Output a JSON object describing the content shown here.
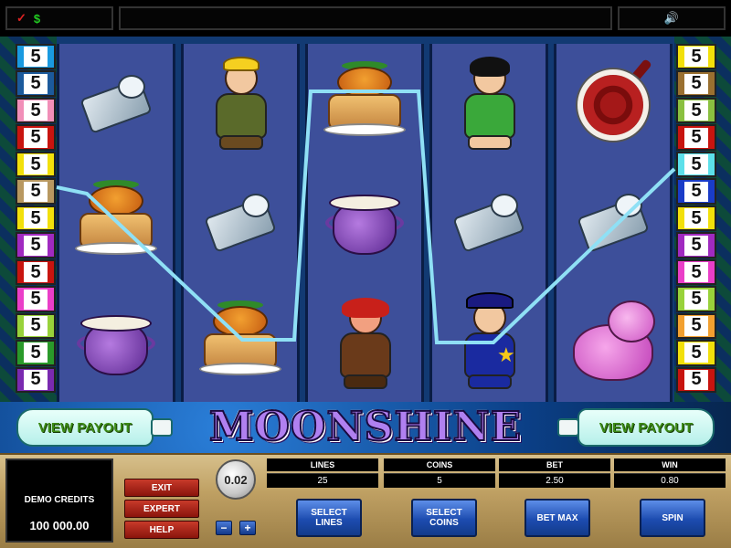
{
  "game": {
    "title": "MOONSHINE"
  },
  "topbar": {
    "icons": [
      "check-icon",
      "dollar-icon",
      "sound-icon"
    ],
    "check_glyph": "✓",
    "dollar_glyph": "$",
    "sound_glyph": "🔊"
  },
  "paylines": {
    "left_numbers": [
      "5",
      "5",
      "5",
      "5",
      "5",
      "5",
      "5",
      "5",
      "5",
      "5",
      "5",
      "5",
      "5"
    ],
    "right_numbers": [
      "5",
      "5",
      "5",
      "5",
      "5",
      "5",
      "5",
      "5",
      "5",
      "5",
      "5",
      "5",
      "5"
    ],
    "left_colors": [
      "#1a9ae0",
      "#1c5a9c",
      "#f18fb8",
      "#c8140f",
      "#f2e00a",
      "#b89860",
      "#f2e00a",
      "#a02ac0",
      "#c8140f",
      "#ea3ec8",
      "#98d23a",
      "#2a9a2a",
      "#7a2ab0"
    ],
    "right_colors": [
      "#f2e00a",
      "#9a7030",
      "#8ac040",
      "#c8140f",
      "#5ce0ea",
      "#1a3cc8",
      "#f2e00a",
      "#a02ac0",
      "#ea3ec8",
      "#98d23a",
      "#f2a030",
      "#f2e00a",
      "#c8140f"
    ]
  },
  "reels": [
    [
      "sardines",
      "pumpkin-pie",
      "moonshine-pot"
    ],
    [
      "hillbilly-banjo",
      "sardines",
      "pumpkin-pie"
    ],
    [
      "pumpkin-pie",
      "moonshine-pot",
      "red-haired-troll"
    ],
    [
      "big-guy",
      "sardines",
      "sheriff"
    ],
    [
      "beans-pan",
      "sardines",
      "pink-pig"
    ]
  ],
  "banner": {
    "view_payout_left": "VIEW PAYOUT",
    "view_payout_right": "VIEW PAYOUT"
  },
  "panel": {
    "credits_label": "DEMO CREDITS",
    "credits_value": "100 000.00",
    "menu": {
      "exit": "EXIT",
      "expert": "EXPERT",
      "help": "HELP"
    },
    "coin_value": "0.02",
    "coin_minus": "−",
    "coin_plus": "+",
    "stats": {
      "lines_label": "LINES",
      "lines_value": "25",
      "coins_label": "COINS",
      "coins_value": "5",
      "bet_label": "BET",
      "bet_value": "2.50",
      "win_label": "WIN",
      "win_value": "0.80"
    },
    "buttons": {
      "select_lines": "SELECT LINES",
      "select_coins": "SELECT COINS",
      "bet_max": "BET MAX",
      "spin": "SPIN"
    }
  },
  "colors": {
    "payline": "#8fe0f5",
    "reel_bg": "#3d4f9a",
    "menu_red": "#a81f14",
    "action_blue": "#1d4cb0"
  }
}
